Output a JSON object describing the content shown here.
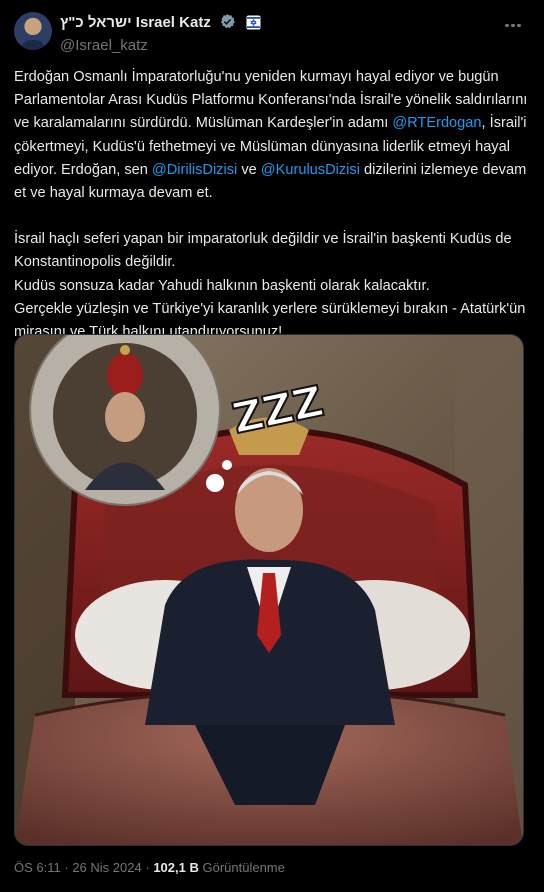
{
  "author": {
    "display_name": "ישראל כ\"ץ Israel Katz",
    "handle": "@Israel_katz",
    "verified_icon": "verified-badge-icon",
    "affiliate_icon": "affiliation-flag-icon"
  },
  "body": {
    "p1_a": "Erdoğan Osmanlı İmparatorluğu'nu yeniden kurmayı hayal ediyor ve bugün Parlamentolar Arası Kudüs Platformu Konferansı'nda İsrail'e yönelik saldırılarını ve karalamalarını sürdürdü. Müslüman Kardeşler'in adamı ",
    "mention1": "@RTErdogan",
    "p1_b": ", İsrail'i çökertmeyi, Kudüs'ü fethetmeyi ve Müslüman dünyasına liderlik etmeyi hayal ediyor.  Erdoğan, sen ",
    "mention2": "@DirilisDizisi",
    "p1_c": " ve ",
    "mention3": "@KurulusDizisi",
    "p1_d": " dizilerini izlemeye devam et ve hayal kurmaya devam et.",
    "p2": "İsrail haçlı seferi yapan bir imparatorluk değildir ve İsrail'in başkenti Kudüs de Konstantinopolis değildir.",
    "p3": "Kudüs sonsuza kadar Yahudi halkının başkenti olarak kalacaktır.",
    "p4": "Gerçekle yüzleşin ve Türkiye'yi karanlık yerlere sürüklemeyi bırakın - Atatürk'ün mirasını ve Türk halkını utandırıyorsunuz!"
  },
  "image": {
    "bubble_text": "ZZZ"
  },
  "meta": {
    "time": "ÖS 6:11",
    "separator": "·",
    "date": "26 Nis 2024",
    "views": "102,1 B",
    "views_label": "Görüntülenme"
  },
  "colors": {
    "link": "#1d9bf0",
    "muted": "#71767b",
    "text": "#e7e9ea",
    "background": "#000000"
  }
}
